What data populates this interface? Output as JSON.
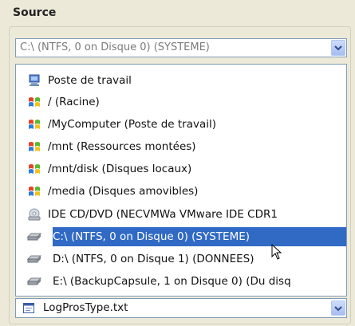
{
  "section": {
    "title": "Source"
  },
  "combo": {
    "value": "C:\\  (NTFS, 0 on Disque 0) (SYSTEME)"
  },
  "items": [
    {
      "label": "Poste de travail",
      "icon": "computer-icon"
    },
    {
      "label": "/ (Racine)",
      "icon": "windows-flag-icon"
    },
    {
      "label": "/MyComputer (Poste de travail)",
      "icon": "windows-flag-icon"
    },
    {
      "label": "/mnt (Ressources montées)",
      "icon": "windows-flag-icon"
    },
    {
      "label": "/mnt/disk (Disques locaux)",
      "icon": "windows-flag-icon"
    },
    {
      "label": "/media (Disques amovibles)",
      "icon": "windows-flag-icon"
    },
    {
      "label": "IDE CD/DVD (NECVMWa VMware IDE CDR1",
      "icon": "cd-drive-icon"
    },
    {
      "label": "C:\\  (NTFS, 0 on Disque 0) (SYSTEME)",
      "icon": "hard-drive-icon",
      "selected": true
    },
    {
      "label": "D:\\  (NTFS, 0 on Disque 1) (DONNEES)",
      "icon": "hard-drive-icon"
    },
    {
      "label": "E:\\  (BackupCapsule, 1 on Disque 0) (Du disq",
      "icon": "hard-drive-icon"
    }
  ],
  "file": {
    "label": "LogProsType.txt"
  },
  "colors": {
    "selection": "#316ac5",
    "border": "#7f9db9",
    "background": "#ece9d8"
  }
}
